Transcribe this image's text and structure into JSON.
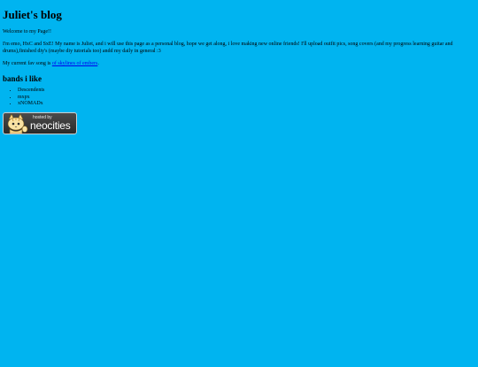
{
  "title": "Juliet's blog",
  "welcome": "Welcome to my Page!!",
  "intro": "I'm emo, HxC and SxE! My name is Juliet, and i will use this page as a personal blog, hope we get along, i love making new online friends! I'll upload outfit pics, song covers (and my progress learning guitar and drums),finished diy's (maybe diy tutorials too) andd my daily in general :3",
  "fav_song": {
    "prefix": "My current fav song is ",
    "link_text": "of skylines of embers",
    "suffix": "."
  },
  "bands": {
    "heading": "bands i like",
    "items": [
      "Descendents",
      "mxpx",
      "xNOMADx"
    ]
  },
  "badge": {
    "small": "hosted by",
    "big": "neocities"
  }
}
